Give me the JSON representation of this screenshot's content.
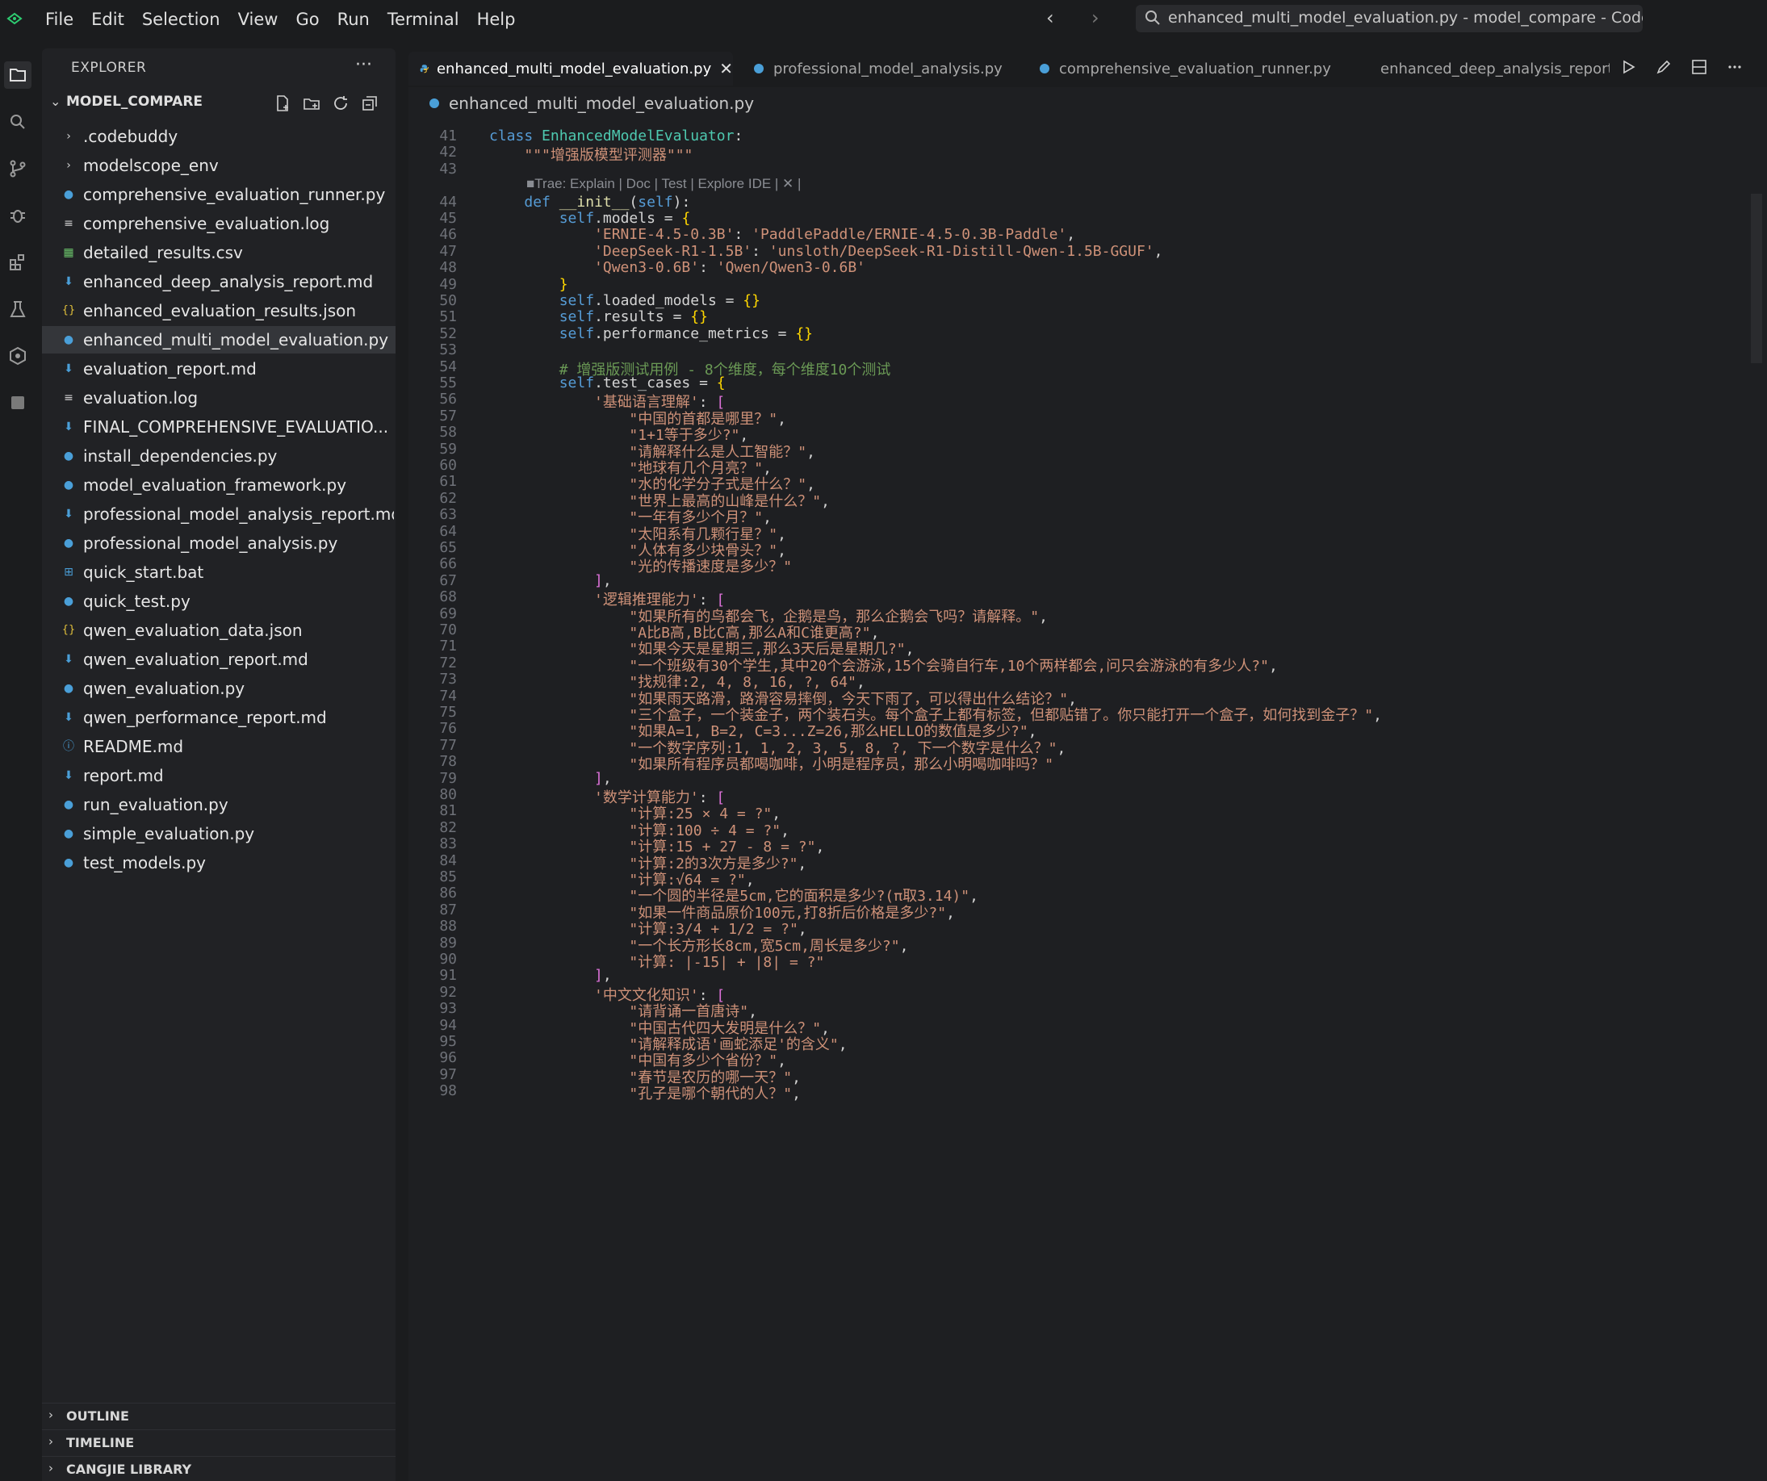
{
  "menu": [
    "File",
    "Edit",
    "Selection",
    "View",
    "Go",
    "Run",
    "Terminal",
    "Help"
  ],
  "search": {
    "text": "enhanced_multi_model_evaluation.py - model_compare - CodeBuddy"
  },
  "explorer": {
    "title": "EXPLORER",
    "more": "···",
    "root": "MODEL_COMPARE",
    "files": [
      {
        "name": ".codebuddy",
        "type": "folder"
      },
      {
        "name": "modelscope_env",
        "type": "folder"
      },
      {
        "name": "comprehensive_evaluation_runner.py",
        "type": "py"
      },
      {
        "name": "comprehensive_evaluation.log",
        "type": "log"
      },
      {
        "name": "detailed_results.csv",
        "type": "csv"
      },
      {
        "name": "enhanced_deep_analysis_report.md",
        "type": "md"
      },
      {
        "name": "enhanced_evaluation_results.json",
        "type": "json"
      },
      {
        "name": "enhanced_multi_model_evaluation.py",
        "type": "py"
      },
      {
        "name": "evaluation_report.md",
        "type": "md"
      },
      {
        "name": "evaluation.log",
        "type": "log"
      },
      {
        "name": "FINAL_COMPREHENSIVE_EVALUATIO...",
        "type": "md"
      },
      {
        "name": "install_dependencies.py",
        "type": "py"
      },
      {
        "name": "model_evaluation_framework.py",
        "type": "py"
      },
      {
        "name": "professional_model_analysis_report.md",
        "type": "md"
      },
      {
        "name": "professional_model_analysis.py",
        "type": "py"
      },
      {
        "name": "quick_start.bat",
        "type": "bat"
      },
      {
        "name": "quick_test.py",
        "type": "py"
      },
      {
        "name": "qwen_evaluation_data.json",
        "type": "json"
      },
      {
        "name": "qwen_evaluation_report.md",
        "type": "md"
      },
      {
        "name": "qwen_evaluation.py",
        "type": "py"
      },
      {
        "name": "qwen_performance_report.md",
        "type": "md"
      },
      {
        "name": "README.md",
        "type": "info"
      },
      {
        "name": "report.md",
        "type": "md"
      },
      {
        "name": "run_evaluation.py",
        "type": "py"
      },
      {
        "name": "simple_evaluation.py",
        "type": "py"
      },
      {
        "name": "test_models.py",
        "type": "py"
      }
    ],
    "sections": [
      "OUTLINE",
      "TIMELINE",
      "CANGJIE LIBRARY"
    ]
  },
  "tabs": [
    {
      "label": "enhanced_multi_model_evaluation.py",
      "icon": "python-icon"
    },
    {
      "label": "professional_model_analysis.py",
      "icon": "python-icon"
    },
    {
      "label": "comprehensive_evaluation_runner.py",
      "icon": "python-icon"
    },
    {
      "label": "enhanced_deep_analysis_report.md",
      "icon": "markdown-icon"
    }
  ],
  "breadcrumb": "enhanced_multi_model_evaluation.py",
  "inlay": "Trae: Explain | Doc | Test | Explore IDE | ✕ |",
  "code": {
    "lines": [
      {
        "n": "41",
        "t": "class EnhancedModelEvaluator:"
      },
      {
        "n": "42",
        "t": "    \"\"\"增强版模型评测器\"\"\""
      },
      {
        "n": "43",
        "t": ""
      },
      {
        "n": "44",
        "t": "    def __init__(self):"
      },
      {
        "n": "45",
        "t": "        self.models = {"
      },
      {
        "n": "46",
        "t": "            'ERNIE-4.5-0.3B': 'PaddlePaddle/ERNIE-4.5-0.3B-Paddle',"
      },
      {
        "n": "47",
        "t": "            'DeepSeek-R1-1.5B': 'unsloth/DeepSeek-R1-Distill-Qwen-1.5B-GGUF',"
      },
      {
        "n": "48",
        "t": "            'Qwen3-0.6B': 'Qwen/Qwen3-0.6B'"
      },
      {
        "n": "49",
        "t": "        }"
      },
      {
        "n": "50",
        "t": "        self.loaded_models = {}"
      },
      {
        "n": "51",
        "t": "        self.results = {}"
      },
      {
        "n": "52",
        "t": "        self.performance_metrics = {}"
      },
      {
        "n": "53",
        "t": ""
      },
      {
        "n": "54",
        "t": "        # 增强版测试用例 - 8个维度，每个维度10个测试"
      },
      {
        "n": "55",
        "t": "        self.test_cases = {"
      },
      {
        "n": "56",
        "t": "            '基础语言理解': ["
      },
      {
        "n": "57",
        "t": "                \"中国的首都是哪里？\","
      },
      {
        "n": "58",
        "t": "                \"1+1等于多少?\","
      },
      {
        "n": "59",
        "t": "                \"请解释什么是人工智能？\","
      },
      {
        "n": "60",
        "t": "                \"地球有几个月亮？\","
      },
      {
        "n": "61",
        "t": "                \"水的化学分子式是什么？\","
      },
      {
        "n": "62",
        "t": "                \"世界上最高的山峰是什么？\","
      },
      {
        "n": "63",
        "t": "                \"一年有多少个月？\","
      },
      {
        "n": "64",
        "t": "                \"太阳系有几颗行星？\","
      },
      {
        "n": "65",
        "t": "                \"人体有多少块骨头？\","
      },
      {
        "n": "66",
        "t": "                \"光的传播速度是多少？\""
      },
      {
        "n": "67",
        "t": "            ],"
      },
      {
        "n": "68",
        "t": "            '逻辑推理能力': ["
      },
      {
        "n": "69",
        "t": "                \"如果所有的鸟都会飞，企鹅是鸟，那么企鹅会飞吗？请解释。\","
      },
      {
        "n": "70",
        "t": "                \"A比B高,B比C高,那么A和C谁更高?\","
      },
      {
        "n": "71",
        "t": "                \"如果今天是星期三,那么3天后是星期几?\","
      },
      {
        "n": "72",
        "t": "                \"一个班级有30个学生,其中20个会游泳,15个会骑自行车,10个两样都会,问只会游泳的有多少人?\","
      },
      {
        "n": "73",
        "t": "                \"找规律:2, 4, 8, 16, ?, 64\","
      },
      {
        "n": "74",
        "t": "                \"如果雨天路滑，路滑容易摔倒，今天下雨了，可以得出什么结论？\","
      },
      {
        "n": "75",
        "t": "                \"三个盒子，一个装金子，两个装石头。每个盒子上都有标签，但都贴错了。你只能打开一个盒子，如何找到金子？\","
      },
      {
        "n": "76",
        "t": "                \"如果A=1, B=2, C=3...Z=26,那么HELLO的数值是多少?\","
      },
      {
        "n": "77",
        "t": "                \"一个数字序列:1, 1, 2, 3, 5, 8, ?, 下一个数字是什么？\","
      },
      {
        "n": "78",
        "t": "                \"如果所有程序员都喝咖啡，小明是程序员，那么小明喝咖啡吗？\""
      },
      {
        "n": "79",
        "t": "            ],"
      },
      {
        "n": "80",
        "t": "            '数学计算能力': ["
      },
      {
        "n": "81",
        "t": "                \"计算:25 × 4 = ?\","
      },
      {
        "n": "82",
        "t": "                \"计算:100 ÷ 4 = ?\","
      },
      {
        "n": "83",
        "t": "                \"计算:15 + 27 - 8 = ?\","
      },
      {
        "n": "84",
        "t": "                \"计算:2的3次方是多少?\","
      },
      {
        "n": "85",
        "t": "                \"计算:√64 = ?\","
      },
      {
        "n": "86",
        "t": "                \"一个圆的半径是5cm,它的面积是多少?(π取3.14)\","
      },
      {
        "n": "87",
        "t": "                \"如果一件商品原价100元,打8折后价格是多少?\","
      },
      {
        "n": "88",
        "t": "                \"计算:3/4 + 1/2 = ?\","
      },
      {
        "n": "89",
        "t": "                \"一个长方形长8cm,宽5cm,周长是多少?\","
      },
      {
        "n": "90",
        "t": "                \"计算: |-15| + |8| = ?\""
      },
      {
        "n": "91",
        "t": "            ],"
      },
      {
        "n": "92",
        "t": "            '中文文化知识': ["
      },
      {
        "n": "93",
        "t": "                \"请背诵一首唐诗\","
      },
      {
        "n": "94",
        "t": "                \"中国古代四大发明是什么？\","
      },
      {
        "n": "95",
        "t": "                \"请解释成语'画蛇添足'的含义\","
      },
      {
        "n": "96",
        "t": "                \"中国有多少个省份？\","
      },
      {
        "n": "97",
        "t": "                \"春节是农历的哪一天？\","
      },
      {
        "n": "98",
        "t": "                \"孔子是哪个朝代的人？\","
      }
    ]
  },
  "colors": {
    "keyword": "#569cd6",
    "class": "#4ec9b0",
    "string": "#ce9178",
    "comment": "#6a9955",
    "bracket": "#ffd700",
    "bracket2": "#da70d6"
  }
}
